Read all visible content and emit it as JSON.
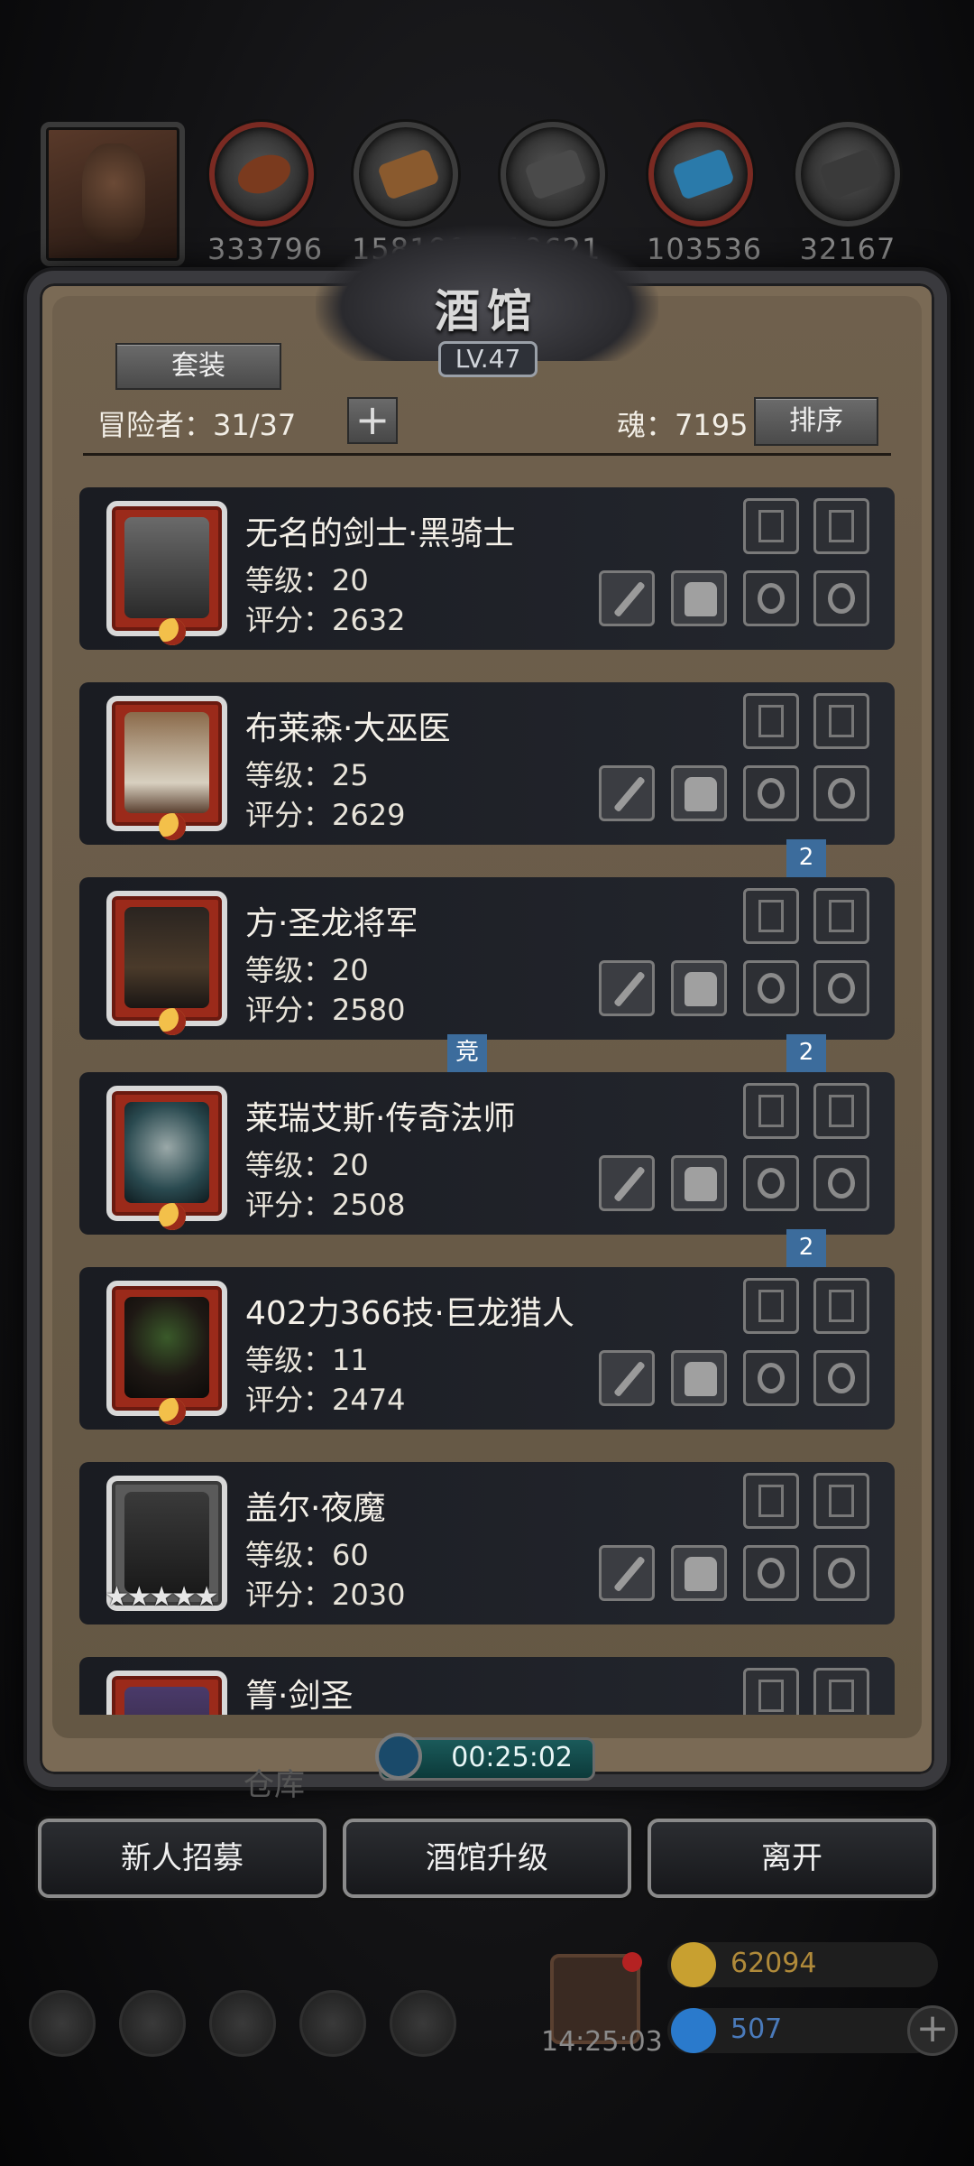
{
  "resources": [
    {
      "name": "meat",
      "value": "333796"
    },
    {
      "name": "wood",
      "value": "158190"
    },
    {
      "name": "iron",
      "value": "19621"
    },
    {
      "name": "crystal",
      "value": "103536"
    },
    {
      "name": "metal",
      "value": "32167"
    }
  ],
  "tavern": {
    "title": "酒馆",
    "level": "LV.47",
    "set_button": "套装",
    "adventurers_label": "冒险者：31/37",
    "soul_label": "魂：7195",
    "sort_button": "排序"
  },
  "heroes": [
    {
      "name": "无名的剑士·黑骑士",
      "level": "等级：20",
      "score": "评分：2632",
      "weapon": "sword-icon"
    },
    {
      "name": "布莱森·大巫医",
      "level": "等级：25",
      "score": "评分：2629",
      "weapon": "staff-icon"
    },
    {
      "name": "方·圣龙将军",
      "level": "等级：20",
      "score": "评分：2580",
      "weapon": "sword-icon"
    },
    {
      "name": "莱瑞艾斯·传奇法师",
      "level": "等级：20",
      "score": "评分：2508",
      "weapon": "staff-icon"
    },
    {
      "name": "402力366技·巨龙猎人",
      "level": "等级：11",
      "score": "评分：2474",
      "weapon": "bow-icon"
    },
    {
      "name": "盖尔·夜魔",
      "level": "等级：60",
      "score": "评分：2030",
      "weapon": "sword-icon",
      "stars": "★★★★★"
    },
    {
      "name": "箐·剑圣",
      "level": "",
      "score": ""
    }
  ],
  "badges": {
    "number": "2",
    "compete": "竞"
  },
  "timer": "00:25:02",
  "ghost_label": "仓库",
  "buttons": {
    "recruit": "新人招募",
    "upgrade": "酒馆升级",
    "leave": "离开"
  },
  "bottom": {
    "clock": "14:25:03",
    "gold": "62094",
    "gems": "507"
  },
  "colors": {
    "accent_blue": "#3c6c9c",
    "hero_frame_red": "#9b2a1a",
    "gold": "#c8a030"
  }
}
